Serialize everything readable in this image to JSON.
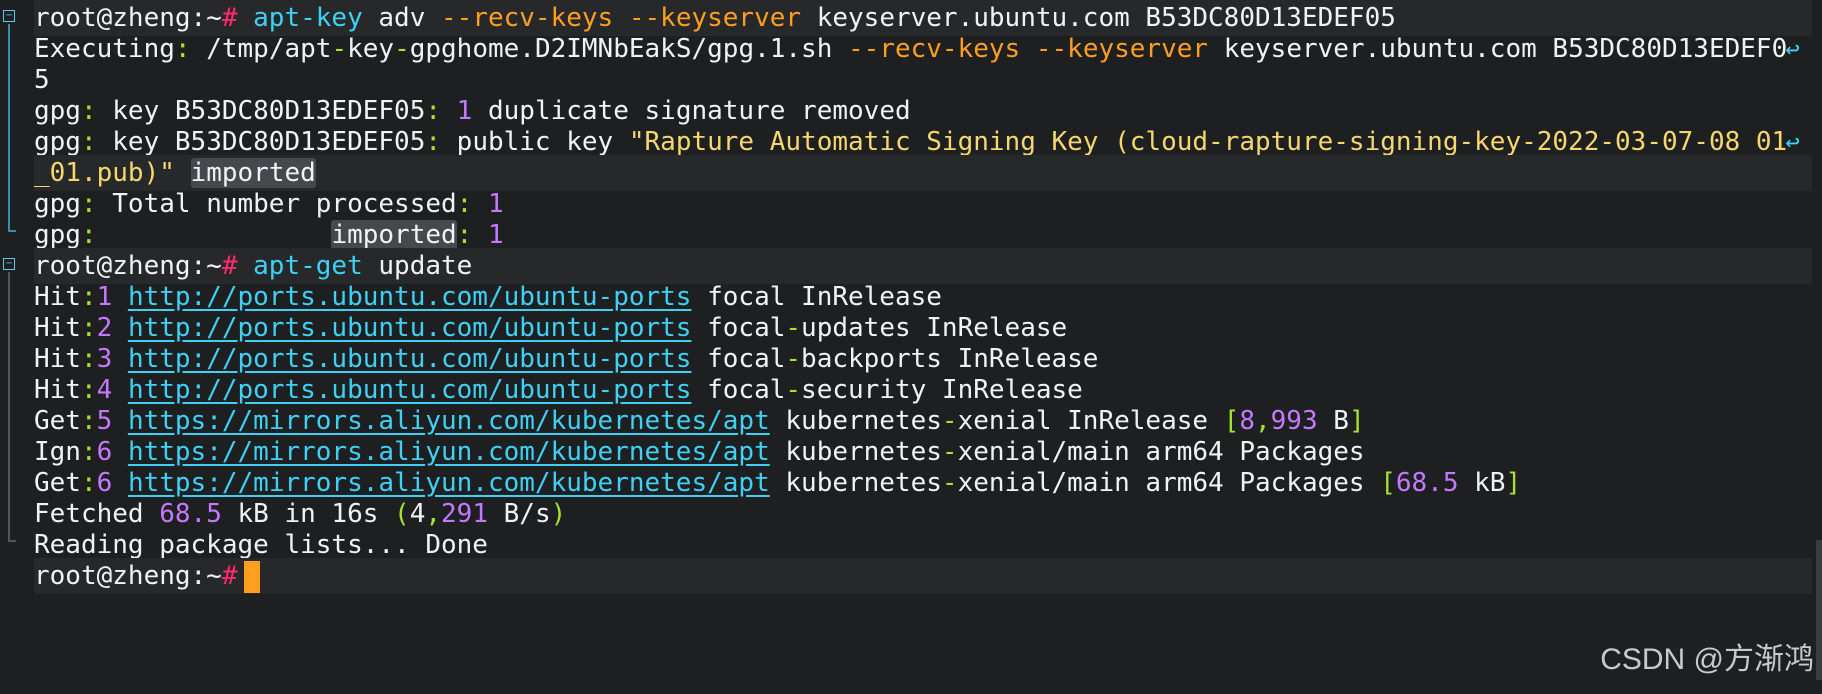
{
  "prompt": {
    "user_host": "root@zheng:~",
    "hash": "#"
  },
  "cmd1": {
    "program": "apt-key",
    "args": " adv ",
    "flag1": "--recv-keys",
    "flag2": "--keyserver",
    "rest": " keyserver.ubuntu.com B53DC80D13EDEF05"
  },
  "line_exec": {
    "label": "Executing",
    "colon": ":",
    "path_a": " /tmp/apt",
    "dash": "-",
    "path_b": "key",
    "path_c": "gpghome.D2IMNbEakS/gpg.1.sh ",
    "flag1": "--recv-keys",
    "flag2": "--keyserver",
    "rest": " keyserver.ubuntu.com B53DC80D13EDEF0",
    "wrapped": "5"
  },
  "line_dup": {
    "prefix": "gpg",
    "colon": ":",
    "key": " key B53DC80D13EDEF05",
    "count": "1",
    "text": " duplicate signature removed"
  },
  "line_pub": {
    "prefix": "gpg",
    "colon": ":",
    "key": " key B53DC80D13EDEF05",
    "text": " public key ",
    "quote": "\"Rapture Automatic Signing Key (cloud-rapture-signing-key-2022-03-07-08_01",
    "quote_wrap": "_01.pub)\"",
    "imported": "imported"
  },
  "line_total": {
    "prefix": "gpg",
    "colon": ":",
    "text": " Total number processed",
    "count": "1"
  },
  "line_imported": {
    "prefix": "gpg",
    "colon": ":",
    "pad": "               ",
    "word": "imported",
    "count": "1"
  },
  "cmd2": {
    "program": "apt-get",
    "args": " update"
  },
  "apt_lines": [
    {
      "tag": "Hit",
      "n": "1",
      "url": "http://ports.ubuntu.com/ubuntu-ports",
      "a": " focal",
      "b": " InRelease"
    },
    {
      "tag": "Hit",
      "n": "2",
      "url": "http://ports.ubuntu.com/ubuntu-ports",
      "a": " focal",
      "b": "updates InRelease"
    },
    {
      "tag": "Hit",
      "n": "3",
      "url": "http://ports.ubuntu.com/ubuntu-ports",
      "a": " focal",
      "b": "backports InRelease"
    },
    {
      "tag": "Hit",
      "n": "4",
      "url": "http://ports.ubuntu.com/ubuntu-ports",
      "a": " focal",
      "b": "security InRelease"
    },
    {
      "tag": "Get",
      "n": "5",
      "url": "https://mirrors.aliyun.com/kubernetes/apt",
      "a": " kubernetes",
      "b": "xenial InRelease ",
      "size_num_a": "8",
      "size_num_b": "993",
      "size_unit": " B"
    },
    {
      "tag": "Ign",
      "n": "6",
      "url": "https://mirrors.aliyun.com/kubernetes/apt",
      "a": " kubernetes",
      "b": "xenial/main arm64 Packages"
    },
    {
      "tag": "Get",
      "n": "6",
      "url": "https://mirrors.aliyun.com/kubernetes/apt",
      "a": " kubernetes",
      "b": "xenial/main arm64 Packages ",
      "size_num": "68.5",
      "size_unit": " kB"
    }
  ],
  "fetched": {
    "label": "Fetched ",
    "amount": "68.5",
    "text": " kB in 16s ",
    "rate_a": "4",
    "rate_b": "291",
    "unit": " B/s"
  },
  "reading": {
    "text": "Reading package lists... Done"
  },
  "watermark": "CSDN @方渐鸿",
  "colors": {
    "background": "#1d1f21",
    "command": "#3fd0f5",
    "flag": "#ff9e1f",
    "prompt_hash": "#ff2a6d",
    "number": "#c678ff",
    "string": "#f5d76e",
    "cursor": "#ff9e1f"
  },
  "icons": {
    "wrap": "wrap-arrow-icon",
    "fold": "fold-minus-icon"
  }
}
